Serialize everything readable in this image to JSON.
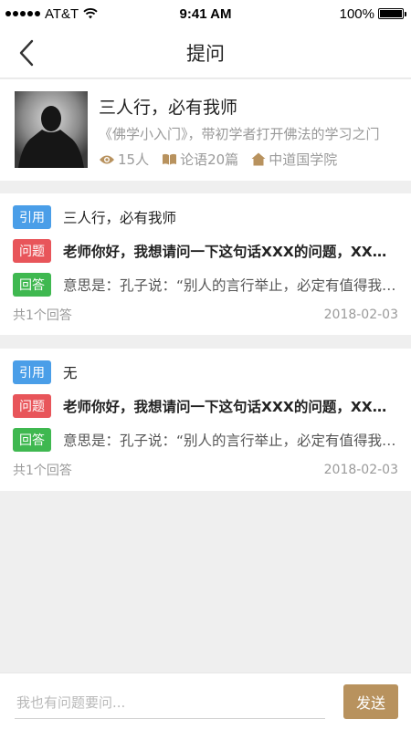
{
  "status_bar": {
    "carrier": "AT&T",
    "time": "9:41 AM",
    "battery": "100%"
  },
  "nav": {
    "title": "提问"
  },
  "course": {
    "title": "三人行，必有我师",
    "description": "《佛学小入门》，带初学者打开佛法的学习之门",
    "views": "15人",
    "articles": "论语20篇",
    "academy": "中道国学院"
  },
  "questions": [
    {
      "quote_tag": "引用",
      "quote": "三人行，必有我师",
      "question_tag": "问题",
      "question": "老师你好，我想请问一下这句话XXX的问题，XXX是什么意思",
      "answer_tag": "回答",
      "answer": "意思是：孔子说：“别人的言行举止，必定有值得我学习的地方”",
      "answer_count": "共1个回答",
      "date": "2018-02-03"
    },
    {
      "quote_tag": "引用",
      "quote": "无",
      "question_tag": "问题",
      "question": "老师你好，我想请问一下这句话XXX的问题，XXX是什么意思",
      "answer_tag": "回答",
      "answer": "意思是：孔子说：“别人的言行举止，必定有值得我学习的地方”",
      "answer_count": "共1个回答",
      "date": "2018-02-03"
    }
  ],
  "composer": {
    "placeholder": "我也有问题要问...",
    "send_label": "发送"
  },
  "colors": {
    "accent": "#b8925e",
    "tag_quote": "#4a9ee8",
    "tag_question": "#e8555a",
    "tag_answer": "#3fb850"
  }
}
